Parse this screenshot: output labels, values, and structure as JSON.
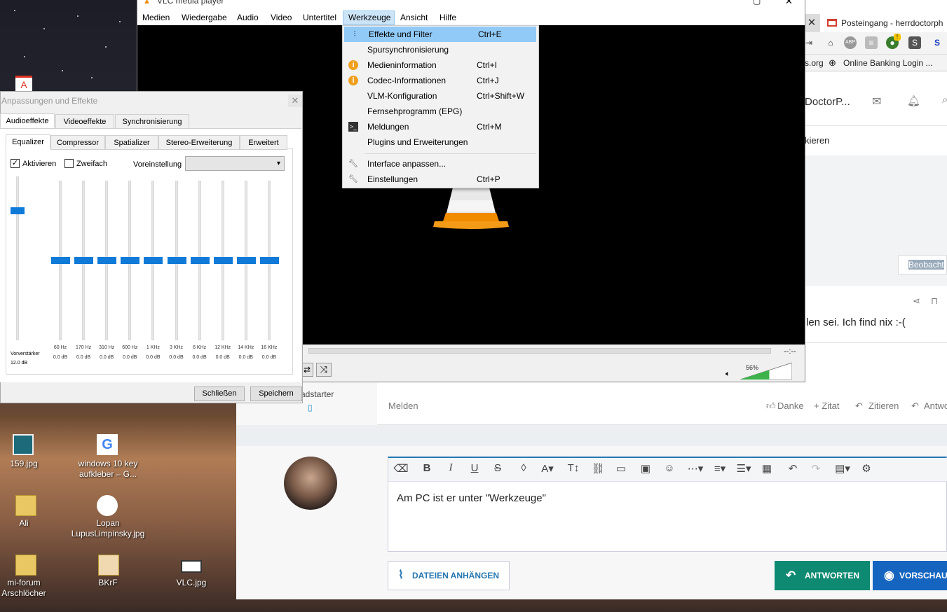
{
  "vlc": {
    "title": "VLC media player",
    "menu": [
      "Medien",
      "Wiedergabe",
      "Audio",
      "Video",
      "Untertitel",
      "Werkzeuge",
      "Ansicht",
      "Hilfe"
    ],
    "time": "--:--",
    "volume": "56%",
    "volume_level": 0.56,
    "tools_menu": [
      {
        "label": "Effekte und Filter",
        "shortcut": "Ctrl+E",
        "icon": "sliders-icon"
      },
      {
        "label": "Spursynchronisierung",
        "shortcut": "",
        "icon": ""
      },
      {
        "label": "Medieninformation",
        "shortcut": "Ctrl+I",
        "icon": "info-icon"
      },
      {
        "label": "Codec-Informationen",
        "shortcut": "Ctrl+J",
        "icon": "info-icon"
      },
      {
        "label": "VLM-Konfiguration",
        "shortcut": "Ctrl+Shift+W",
        "icon": ""
      },
      {
        "label": "Fernsehprogramm (EPG)",
        "shortcut": "",
        "icon": ""
      },
      {
        "label": "Meldungen",
        "shortcut": "Ctrl+M",
        "icon": "terminal-icon"
      },
      {
        "label": "Plugins und Erweiterungen",
        "shortcut": "",
        "icon": ""
      },
      {
        "label": "Interface anpassen...",
        "shortcut": "",
        "icon": "wrench-icon"
      },
      {
        "label": "Einstellungen",
        "shortcut": "Ctrl+P",
        "icon": "wrench-icon"
      }
    ]
  },
  "effects": {
    "title": "Anpassungen und Effekte",
    "tabs": [
      "Audioeffekte",
      "Videoeffekte",
      "Synchronisierung"
    ],
    "subtabs": [
      "Equalizer",
      "Compressor",
      "Spatializer",
      "Stereo-Erweiterung",
      "Erweitert"
    ],
    "enable": "Aktivieren",
    "twofold": "Zweifach",
    "preset_label": "Voreinstellung",
    "preamp_label": "Vorverstärker",
    "preamp_value": "12.0 dB",
    "preamp_level": 0.79,
    "bands": [
      {
        "freq": "60 Hz",
        "db": "0.0 dB"
      },
      {
        "freq": "170 Hz",
        "db": "0.0 dB"
      },
      {
        "freq": "310 Hz",
        "db": "0.0 dB"
      },
      {
        "freq": "600 Hz",
        "db": "0.0 dB"
      },
      {
        "freq": "1 KHz",
        "db": "0.0 dB"
      },
      {
        "freq": "3 KHz",
        "db": "0.0 dB"
      },
      {
        "freq": "6 KHz",
        "db": "0.0 dB"
      },
      {
        "freq": "12 KHz",
        "db": "0.0 dB"
      },
      {
        "freq": "14 KHz",
        "db": "0.0 dB"
      },
      {
        "freq": "16 KHz",
        "db": "0.0 dB"
      }
    ],
    "close": "Schließen",
    "save": "Speichern"
  },
  "browser": {
    "tab_title": "Posteingang - herrdoctorph",
    "bookmarks": [
      "s.org",
      "Online Banking Login ..."
    ],
    "user": "DoctorP...",
    "subnav": "kieren",
    "watch": "Beobacht",
    "post_text": "len sei. Ich find nix :-(",
    "sidebar_text": "adstarter",
    "actions": [
      "Melden",
      "Danke",
      "+ Zitat",
      "Zitieren",
      "Antwo"
    ],
    "reply_text": "Am PC ist er unter \"Werkzeuge\"",
    "attach": "DATEIEN ANHÄNGEN",
    "answer": "ANTWORTEN",
    "preview": "VORSCHAU"
  },
  "desktop": {
    "icons": [
      {
        "label": "159.jpg"
      },
      {
        "label": "windows 10 key aufkleber – G..."
      },
      {
        "label": "Ali"
      },
      {
        "label": "Lopan LupusLimpinsky.jpg"
      },
      {
        "label": "mi-forum Arschlöcher"
      },
      {
        "label": "BKrF"
      },
      {
        "label": "VLC.jpg"
      }
    ]
  }
}
